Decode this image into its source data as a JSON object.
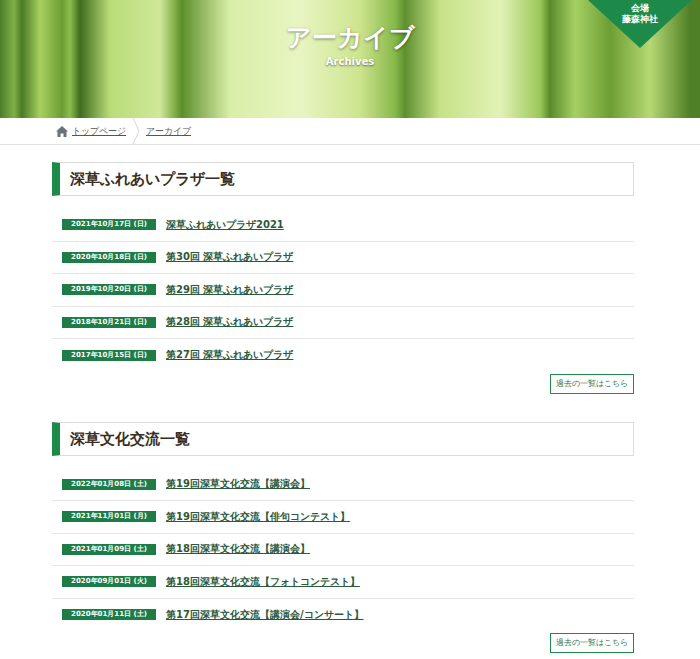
{
  "header": {
    "title": "アーカイブ",
    "subtitle": "Archives",
    "badge": {
      "top": "会場",
      "bottom": "藤森神社"
    }
  },
  "breadcrumb": [
    {
      "label": "トップページ",
      "selected": false
    },
    {
      "label": "アーカイブ",
      "selected": true
    }
  ],
  "sections": [
    {
      "title": "深草ふれあいプラザ一覧",
      "more_button": "過去の一覧はこちら",
      "items": [
        {
          "date": "2021年10月17日 (日)",
          "title": "深草ふれあいプラザ2021"
        },
        {
          "date": "2020年10月18日 (日)",
          "title": "第30回 深草ふれあいプラザ"
        },
        {
          "date": "2019年10月20日 (日)",
          "title": "第29回 深草ふれあいプラザ"
        },
        {
          "date": "2018年10月21日 (日)",
          "title": "第28回 深草ふれあいプラザ"
        },
        {
          "date": "2017年10月15日 (日)",
          "title": "第27回 深草ふれあいプラザ"
        }
      ]
    },
    {
      "title": "深草文化交流一覧",
      "more_button": "過去の一覧はこちら",
      "items": [
        {
          "date": "2022年01月08日 (土)",
          "title": "第19回深草文化交流【講演会】"
        },
        {
          "date": "2021年11月01日 (月)",
          "title": "第19回深草文化交流【俳句コンテスト】"
        },
        {
          "date": "2021年01月09日 (土)",
          "title": "第18回深草文化交流【講演会】"
        },
        {
          "date": "2020年09月01日 (火)",
          "title": "第18回深草文化交流【フォトコンテスト】"
        },
        {
          "date": "2020年01月11日 (土)",
          "title": "第17回深草文化交流【講演会/コンサート】"
        }
      ]
    }
  ]
}
